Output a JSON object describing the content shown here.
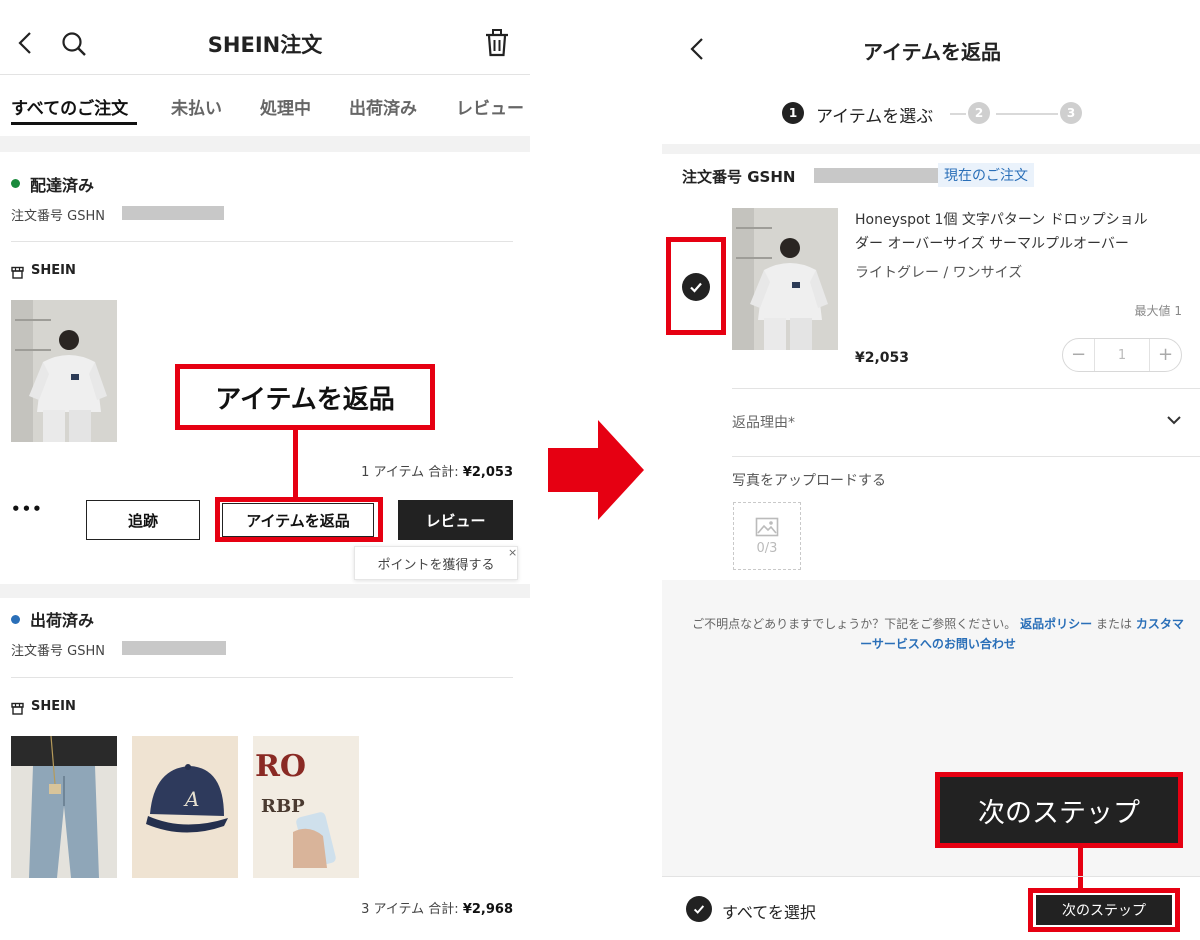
{
  "left": {
    "header": {
      "title": "SHEIN注文"
    },
    "tabs": [
      "すべてのご注文",
      "未払い",
      "処理中",
      "出荷済み",
      "レビュー"
    ],
    "orders": [
      {
        "status": "配達済み",
        "status_color": "#1a8a3c",
        "order_no": "注文番号 GSHN",
        "shop": "SHEIN",
        "summary_count": "1 アイテム  合計:",
        "summary_total": "¥2,053",
        "more": "•••",
        "buttons": {
          "track": "追跡",
          "return": "アイテムを返品",
          "review": "レビュー"
        },
        "tooltip": "ポイントを獲得する"
      },
      {
        "status": "出荷済み",
        "status_color": "#2a6fb8",
        "order_no": "注文番号 GSHN",
        "shop": "SHEIN",
        "summary_count": "3 アイテム  合計:",
        "summary_total": "¥2,968"
      }
    ],
    "callout": "アイテムを返品"
  },
  "right": {
    "header": {
      "title": "アイテムを返品"
    },
    "stepper": {
      "step1_num": "1",
      "step1_label": "アイテムを選ぶ",
      "step2_num": "2",
      "step3_num": "3"
    },
    "order_no": "注文番号 GSHN",
    "current_order_badge": "現在のご注文",
    "product": {
      "name_line1": "Honeyspot 1個 文字パターン ドロップショル",
      "name_line2": "ダー オーバーサイズ サーマルプルオーバー",
      "variant": "ライトグレー / ワンサイズ",
      "max_label": "最大値 1",
      "price": "¥2,053",
      "qty": "1",
      "minus": "−",
      "plus": "+"
    },
    "return_reason_label": "返品理由*",
    "upload_label": "写真をアップロードする",
    "upload_count": "0/3",
    "help": {
      "text": "ご不明点などありますでしょうか？下記をご参照ください。",
      "policy_link": "返品ポリシー",
      "or": "または",
      "cs_link": "カスタマーサービスへのお問い合わせ"
    },
    "callout": "次のステップ",
    "footer": {
      "select_all": "すべてを選択",
      "next_button": "次のステップ"
    }
  },
  "colors": {
    "highlight_red": "#e60012",
    "dark": "#222222",
    "link_blue": "#2a6fb8"
  }
}
